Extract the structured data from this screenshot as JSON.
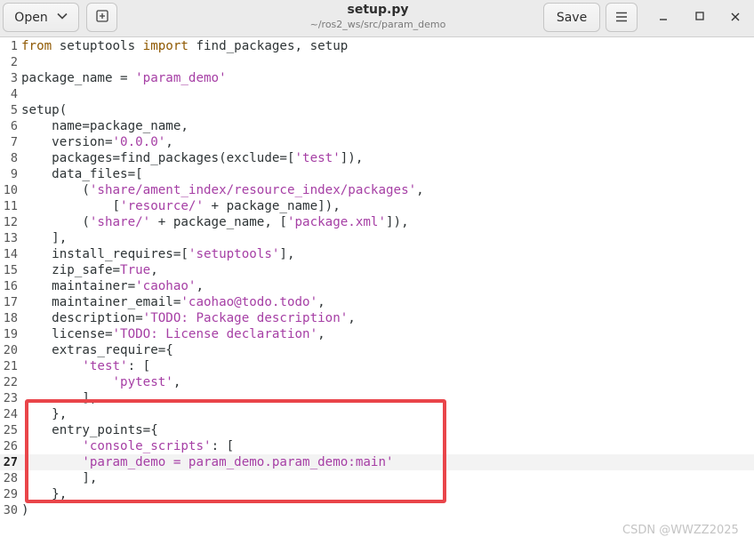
{
  "header": {
    "open_label": "Open",
    "title": "setup.py",
    "subtitle": "~/ros2_ws/src/param_demo",
    "save_label": "Save"
  },
  "icons": {
    "open_dropdown": "chevron-down-icon",
    "new_tab": "new-tab-icon",
    "menu": "hamburger-menu-icon",
    "minimize": "minimize-icon",
    "maximize": "maximize-icon",
    "close": "close-icon"
  },
  "colors": {
    "keyword": "#8f5902",
    "string": "#a63fa5",
    "highlight_box": "#e9454a"
  },
  "editor": {
    "current_line": 27,
    "lines": [
      {
        "n": "1",
        "tokens": [
          {
            "t": "kw",
            "v": "from"
          },
          {
            "t": "",
            "v": " setuptools "
          },
          {
            "t": "kw",
            "v": "import"
          },
          {
            "t": "",
            "v": " find_packages, setup"
          }
        ]
      },
      {
        "n": "2",
        "tokens": []
      },
      {
        "n": "3",
        "tokens": [
          {
            "t": "",
            "v": "package_name = "
          },
          {
            "t": "str",
            "v": "'param_demo'"
          }
        ]
      },
      {
        "n": "4",
        "tokens": []
      },
      {
        "n": "5",
        "tokens": [
          {
            "t": "",
            "v": "setup("
          }
        ]
      },
      {
        "n": "6",
        "tokens": [
          {
            "t": "",
            "v": "    name=package_name,"
          }
        ]
      },
      {
        "n": "7",
        "tokens": [
          {
            "t": "",
            "v": "    version="
          },
          {
            "t": "str",
            "v": "'0.0.0'"
          },
          {
            "t": "",
            "v": ","
          }
        ]
      },
      {
        "n": "8",
        "tokens": [
          {
            "t": "",
            "v": "    packages=find_packages(exclude=["
          },
          {
            "t": "str",
            "v": "'test'"
          },
          {
            "t": "",
            "v": "]),"
          }
        ]
      },
      {
        "n": "9",
        "tokens": [
          {
            "t": "",
            "v": "    data_files=["
          }
        ]
      },
      {
        "n": "10",
        "tokens": [
          {
            "t": "",
            "v": "        ("
          },
          {
            "t": "str",
            "v": "'share/ament_index/resource_index/packages'"
          },
          {
            "t": "",
            "v": ","
          }
        ]
      },
      {
        "n": "11",
        "tokens": [
          {
            "t": "",
            "v": "            ["
          },
          {
            "t": "str",
            "v": "'resource/'"
          },
          {
            "t": "",
            "v": " + package_name]),"
          }
        ]
      },
      {
        "n": "12",
        "tokens": [
          {
            "t": "",
            "v": "        ("
          },
          {
            "t": "str",
            "v": "'share/'"
          },
          {
            "t": "",
            "v": " + package_name, ["
          },
          {
            "t": "str",
            "v": "'package.xml'"
          },
          {
            "t": "",
            "v": "]),"
          }
        ]
      },
      {
        "n": "13",
        "tokens": [
          {
            "t": "",
            "v": "    ],"
          }
        ]
      },
      {
        "n": "14",
        "tokens": [
          {
            "t": "",
            "v": "    install_requires=["
          },
          {
            "t": "str",
            "v": "'setuptools'"
          },
          {
            "t": "",
            "v": "],"
          }
        ]
      },
      {
        "n": "15",
        "tokens": [
          {
            "t": "",
            "v": "    zip_safe="
          },
          {
            "t": "const",
            "v": "True"
          },
          {
            "t": "",
            "v": ","
          }
        ]
      },
      {
        "n": "16",
        "tokens": [
          {
            "t": "",
            "v": "    maintainer="
          },
          {
            "t": "str",
            "v": "'caohao'"
          },
          {
            "t": "",
            "v": ","
          }
        ]
      },
      {
        "n": "17",
        "tokens": [
          {
            "t": "",
            "v": "    maintainer_email="
          },
          {
            "t": "str",
            "v": "'caohao@todo.todo'"
          },
          {
            "t": "",
            "v": ","
          }
        ]
      },
      {
        "n": "18",
        "tokens": [
          {
            "t": "",
            "v": "    description="
          },
          {
            "t": "str",
            "v": "'TODO: Package description'"
          },
          {
            "t": "",
            "v": ","
          }
        ]
      },
      {
        "n": "19",
        "tokens": [
          {
            "t": "",
            "v": "    license="
          },
          {
            "t": "str",
            "v": "'TODO: License declaration'"
          },
          {
            "t": "",
            "v": ","
          }
        ]
      },
      {
        "n": "20",
        "tokens": [
          {
            "t": "",
            "v": "    extras_require={"
          }
        ]
      },
      {
        "n": "21",
        "tokens": [
          {
            "t": "",
            "v": "        "
          },
          {
            "t": "str",
            "v": "'test'"
          },
          {
            "t": "",
            "v": ": ["
          }
        ]
      },
      {
        "n": "22",
        "tokens": [
          {
            "t": "",
            "v": "            "
          },
          {
            "t": "str",
            "v": "'pytest'"
          },
          {
            "t": "",
            "v": ","
          }
        ]
      },
      {
        "n": "23",
        "tokens": [
          {
            "t": "",
            "v": "        ],"
          }
        ]
      },
      {
        "n": "24",
        "tokens": [
          {
            "t": "",
            "v": "    },"
          }
        ]
      },
      {
        "n": "25",
        "tokens": [
          {
            "t": "",
            "v": "    entry_points={"
          }
        ]
      },
      {
        "n": "26",
        "tokens": [
          {
            "t": "",
            "v": "        "
          },
          {
            "t": "str",
            "v": "'console_scripts'"
          },
          {
            "t": "",
            "v": ": ["
          }
        ]
      },
      {
        "n": "27",
        "tokens": [
          {
            "t": "",
            "v": "        "
          },
          {
            "t": "str",
            "v": "'param_demo = param_demo.param_demo:main'"
          }
        ]
      },
      {
        "n": "28",
        "tokens": [
          {
            "t": "",
            "v": "        ],"
          }
        ]
      },
      {
        "n": "29",
        "tokens": [
          {
            "t": "",
            "v": "    },"
          }
        ]
      },
      {
        "n": "30",
        "tokens": [
          {
            "t": "",
            "v": ")"
          }
        ]
      }
    ]
  },
  "watermark": "CSDN @WWZZ2025"
}
